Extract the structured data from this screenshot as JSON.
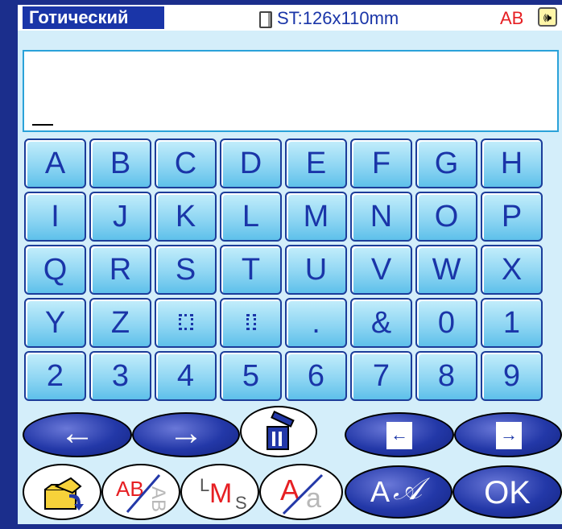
{
  "header": {
    "font_name": "Готический",
    "hoop_size": "ST:126x110mm",
    "sample_label": "AB",
    "speaker_glyph": "🕪"
  },
  "display": {
    "cursor": "_"
  },
  "keys": [
    "A",
    "B",
    "C",
    "D",
    "E",
    "F",
    "G",
    "H",
    "I",
    "J",
    "K",
    "L",
    "M",
    "N",
    "O",
    "P",
    "Q",
    "R",
    "S",
    "T",
    "U",
    "V",
    "W",
    "X",
    "Y",
    "Z",
    "space",
    "double-space",
    ".",
    "&",
    "0",
    "1",
    "2",
    "3",
    "4",
    "5",
    "6",
    "7",
    "8",
    "9"
  ],
  "controls": {
    "cursor_left_glyph": "←",
    "cursor_right_glyph": "→",
    "page_prev_glyph": "←",
    "page_next_glyph": "→",
    "change_case_ab": "AB",
    "change_case_ab_faded": "AB",
    "size_label_l": "L",
    "size_label_m": "M",
    "size_label_s": "S",
    "letter_upper": "A",
    "letter_lower": "a",
    "font_script_upper": "A",
    "font_script_lower": "𝒜",
    "ok_label": "OK"
  },
  "colors": {
    "frame": "#1b2e8c",
    "panel": "#d4eefa",
    "key_text": "#1a35a8",
    "accent_red": "#e61f23"
  }
}
